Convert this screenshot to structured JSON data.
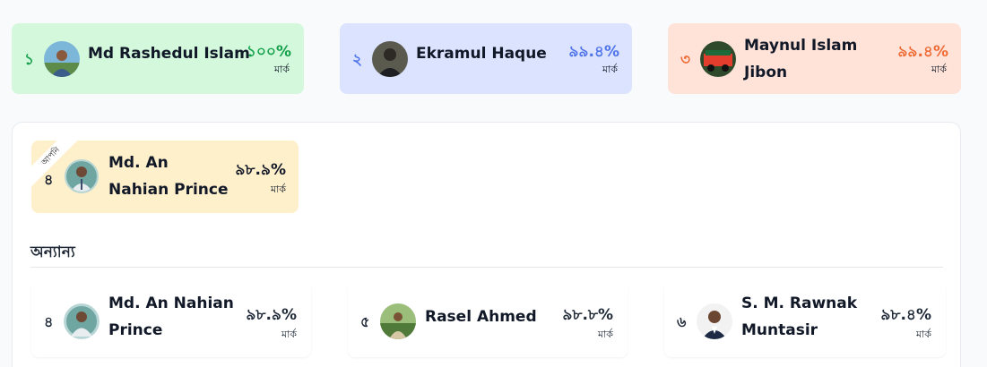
{
  "top": [
    {
      "rank": "১",
      "name": "Md Rashedul Islam",
      "pct": "১০০%",
      "mark": "মার্ক"
    },
    {
      "rank": "২",
      "name": "Ekramul Haque",
      "pct": "৯৯.৪%",
      "mark": "মার্ক"
    },
    {
      "rank": "৩",
      "name_line1": "Maynul Islam",
      "name_line2": "Jibon",
      "pct": "৯৯.৪%",
      "mark": "মার্ক"
    }
  ],
  "you": {
    "ribbon": "আপনি",
    "rank": "৪",
    "name_line1": "Md. An",
    "name_line2": "Nahian Prince",
    "pct": "৯৮.৯%",
    "mark": "মার্ক"
  },
  "others_title": "অন্যান্য",
  "others": [
    {
      "rank": "৪",
      "name_line1": "Md. An Nahian",
      "name_line2": "Prince",
      "pct": "৯৮.৯%",
      "mark": "মার্ক"
    },
    {
      "rank": "৫",
      "name": "Rasel Ahmed",
      "pct": "৯৮.৮%",
      "mark": "মার্ক"
    },
    {
      "rank": "৬",
      "name_line1": "S. M. Rawnak",
      "name_line2": "Muntasir",
      "pct": "৯৮.৪%",
      "mark": "মার্ক"
    }
  ],
  "colors": {
    "first": "#14a04a",
    "second": "#4f73ea",
    "third": "#f06a34",
    "you_bg": "#fff0cc"
  }
}
